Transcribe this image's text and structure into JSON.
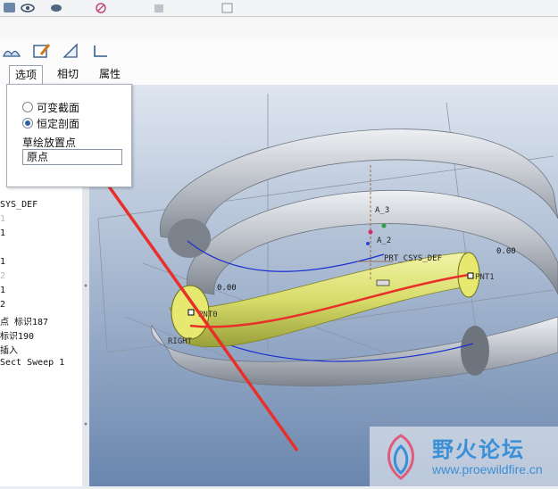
{
  "tabs": [
    {
      "label": "选项"
    },
    {
      "label": "相切"
    },
    {
      "label": "属性"
    }
  ],
  "options_panel": {
    "radio_variable": "可变截面",
    "radio_constant": "恒定剖面",
    "sketch_point_label": "草绘放置点",
    "sketch_point_value": "原点"
  },
  "model_tree": {
    "lines": [
      {
        "text": "SYS_DEF",
        "dim": false
      },
      {
        "text": "1",
        "dim": true
      },
      {
        "text": "1",
        "dim": false
      },
      {
        "text": "1",
        "dim": false
      },
      {
        "text": "2",
        "dim": true
      },
      {
        "text": "1",
        "dim": false
      },
      {
        "text": "2",
        "dim": false
      },
      {
        "text": "点 标识187",
        "dim": false
      },
      {
        "text": "标识190",
        "dim": false
      },
      {
        "text": "插入",
        "dim": false
      },
      {
        "text": "Sect Sweep 1",
        "dim": false
      }
    ]
  },
  "viewport_labels": {
    "axis_a3": "A_3",
    "axis_a2": "A_2",
    "csys": "PRT_CSYS_DEF",
    "dim_left": "0.00",
    "dim_right": "0.00",
    "pnt0": "PNT0",
    "pnt1": "PNT1",
    "right_plane": "RIGHT"
  },
  "watermark": {
    "name": "野火论坛",
    "url": "www.proewildfire.cn"
  },
  "colors": {
    "viewport_top": "#dfe6f0",
    "viewport_bottom": "#6a86ae",
    "sweep_yellow": "#d8dc6a",
    "trajectory_red": "#e8302a",
    "spring_gray": "#b9bec6",
    "accent_blue": "#3b8fd6"
  }
}
